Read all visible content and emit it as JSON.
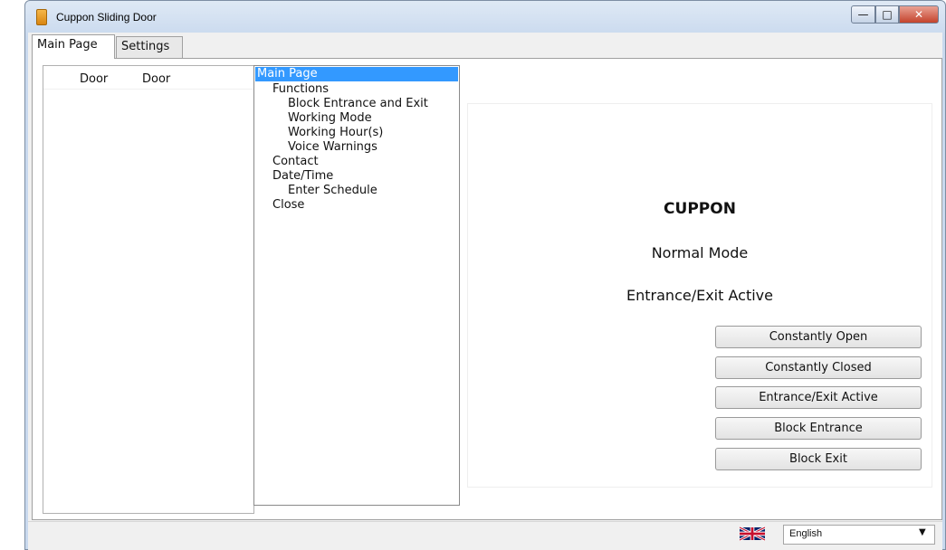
{
  "window": {
    "title": "Cuppon Sliding Door",
    "minimize_glyph": "—",
    "maximize_glyph": "□",
    "close_glyph": "✕"
  },
  "tabs": [
    {
      "label": "Main Page",
      "active": true
    },
    {
      "label": "Settings",
      "active": false
    }
  ],
  "door_list": {
    "columns": [
      "Door",
      "Door"
    ]
  },
  "tree": [
    {
      "label": "Main Page",
      "level": 0,
      "selected": true
    },
    {
      "label": "Functions",
      "level": 1
    },
    {
      "label": "Block Entrance and Exit",
      "level": 2
    },
    {
      "label": "Working Mode",
      "level": 2
    },
    {
      "label": "Working Hour(s)",
      "level": 2
    },
    {
      "label": "Voice Warnings",
      "level": 2
    },
    {
      "label": "Contact",
      "level": 1
    },
    {
      "label": "Date/Time",
      "level": 1
    },
    {
      "label": "Enter Schedule",
      "level": 2
    },
    {
      "label": "Close",
      "level": 1
    }
  ],
  "status": {
    "brand": "CUPPON",
    "mode": "Normal Mode",
    "active_state": "Entrance/Exit Active"
  },
  "actions": [
    {
      "label": "Constantly Open"
    },
    {
      "label": "Constantly Closed"
    },
    {
      "label": "Entrance/Exit Active"
    },
    {
      "label": "Block Entrance"
    },
    {
      "label": "Block Exit"
    }
  ],
  "language": {
    "selected": "English",
    "flag": "uk-flag-icon"
  },
  "colors": {
    "selection": "#3399ff",
    "close_button": "#c4432c"
  }
}
